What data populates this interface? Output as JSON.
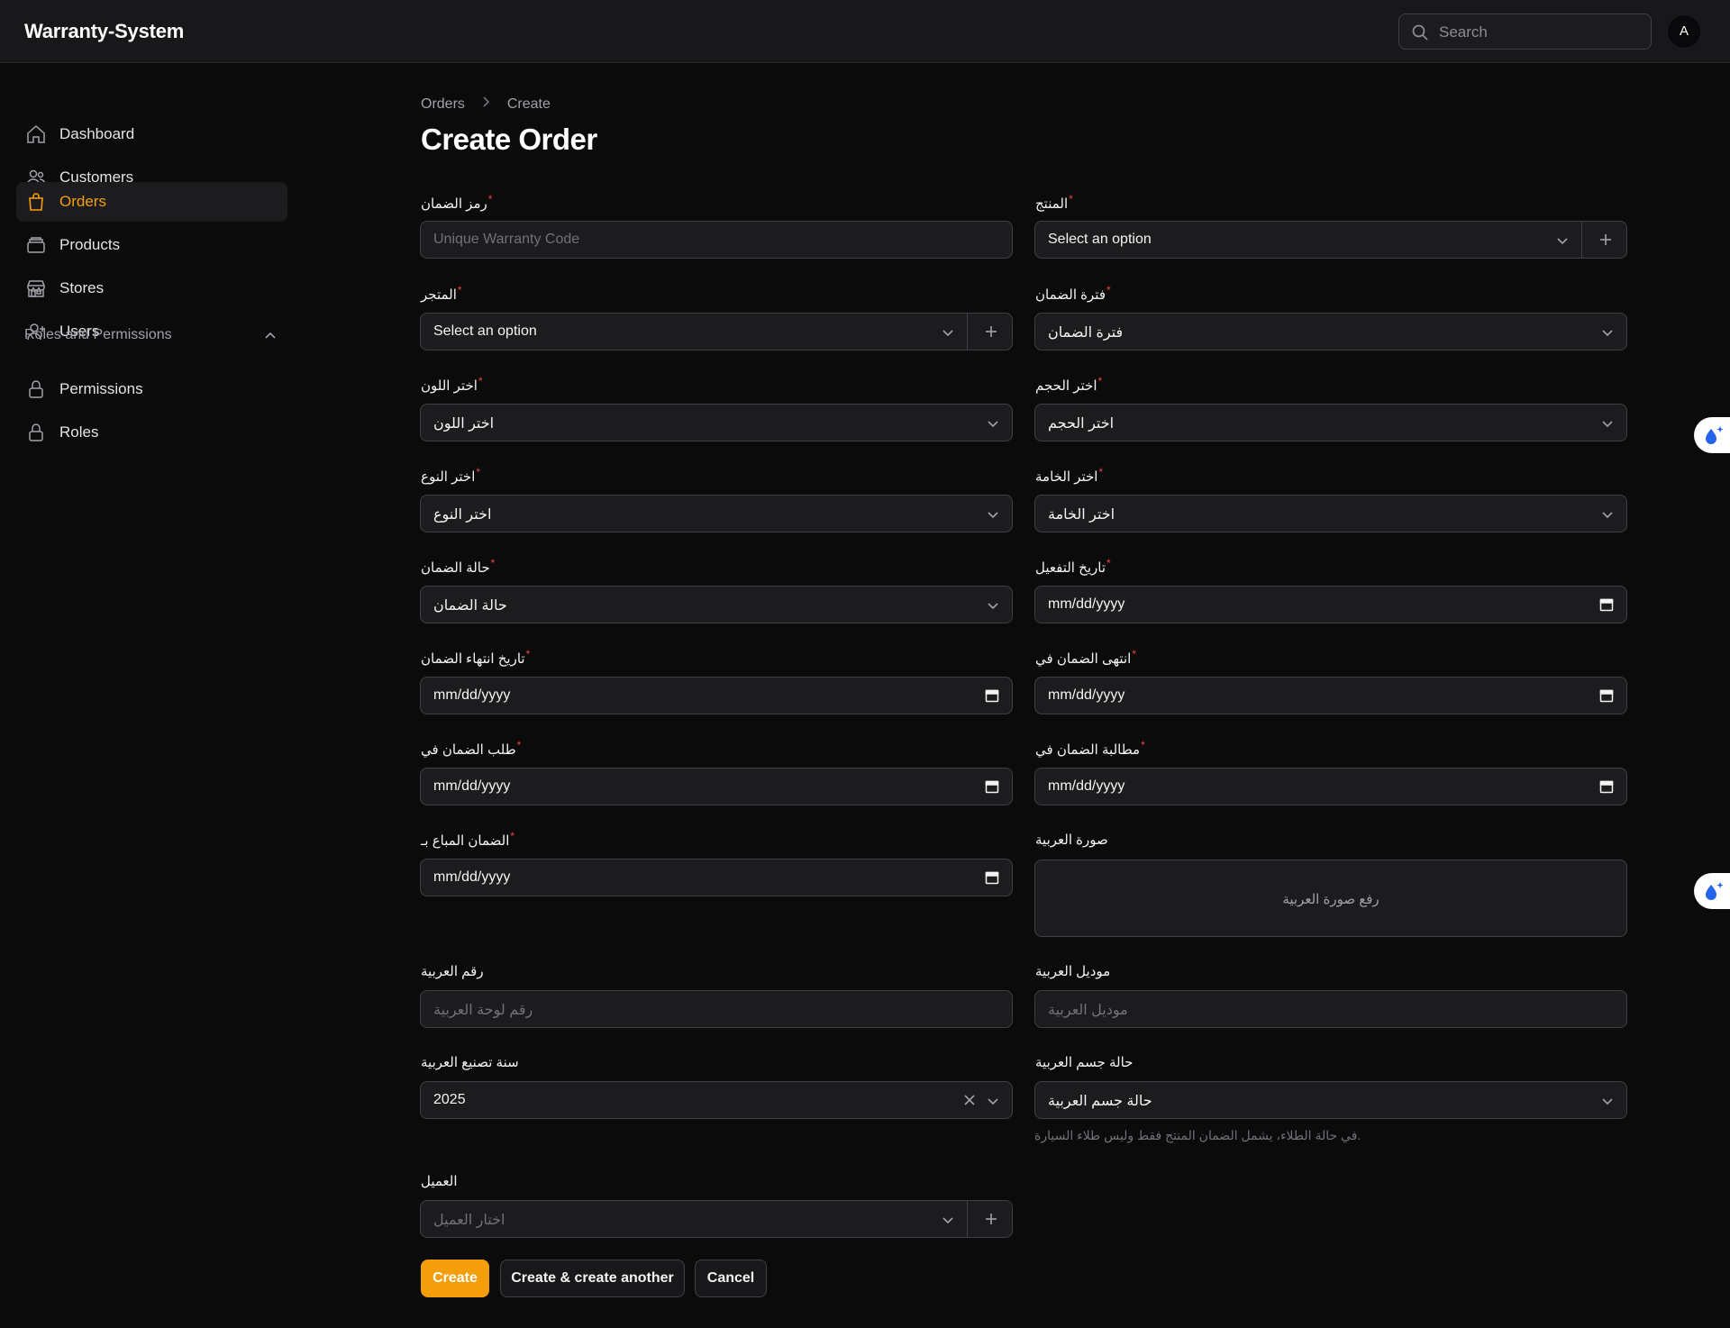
{
  "app": {
    "title": "Warranty-System",
    "avatar_initial": "A"
  },
  "search": {
    "placeholder": "Search"
  },
  "sidebar": {
    "items": [
      {
        "label": "Dashboard",
        "icon": "home-icon",
        "active": false
      },
      {
        "label": "Customers",
        "icon": "users-icon",
        "active": false
      },
      {
        "label": "Orders",
        "icon": "shopping-bag-icon",
        "active": true
      },
      {
        "label": "Products",
        "icon": "box-icon",
        "active": false
      },
      {
        "label": "Stores",
        "icon": "store-icon",
        "active": false
      },
      {
        "label": "Users",
        "icon": "user-plus-icon",
        "active": false
      }
    ],
    "group": {
      "label": "Roles and Permissions",
      "items": [
        {
          "label": "Permissions",
          "icon": "lock-icon"
        },
        {
          "label": "Roles",
          "icon": "lock-icon"
        }
      ]
    }
  },
  "breadcrumb": {
    "parent": "Orders",
    "current": "Create"
  },
  "page": {
    "title": "Create Order"
  },
  "form": {
    "warranty_code": {
      "label": "رمز الضمان",
      "placeholder": "Unique Warranty Code"
    },
    "product": {
      "label": "المنتج",
      "value": "Select an option"
    },
    "store": {
      "label": "المتجر",
      "value": "Select an option"
    },
    "warranty_period": {
      "label": "فترة الضمان",
      "value": "فترة الضمان"
    },
    "color": {
      "label": "اختر اللون",
      "value": "اختر اللون"
    },
    "size": {
      "label": "اختر الحجم",
      "value": "اختر الحجم"
    },
    "type": {
      "label": "اختر النوع",
      "value": "اختر النوع"
    },
    "material": {
      "label": "اختر الخامة",
      "value": "اختر الخامة"
    },
    "warranty_status": {
      "label": "حالة الضمان",
      "value": "حالة الضمان"
    },
    "activation_date": {
      "label": "تاريخ التفعيل",
      "value": "mm/dd/yyyy"
    },
    "warranty_end_date": {
      "label": "تاريخ انتهاء الضمان",
      "value": "mm/dd/yyyy"
    },
    "warranty_ended_at": {
      "label": "انتهى الضمان في",
      "value": "mm/dd/yyyy"
    },
    "warranty_requested_at": {
      "label": "طلب الضمان في",
      "value": "mm/dd/yyyy"
    },
    "warranty_claimed_at": {
      "label": "مطالبة الضمان في",
      "value": "mm/dd/yyyy"
    },
    "warranty_sold_at": {
      "label": "الضمان المباع بـ",
      "value": "mm/dd/yyyy"
    },
    "car_image": {
      "label": "صورة العربية",
      "upload_text": "رفع صورة العربية"
    },
    "car_plate": {
      "label": "رقم العربية",
      "placeholder": "رقم لوحة العربية"
    },
    "car_model": {
      "label": "موديل العربية",
      "placeholder": "موديل العربية"
    },
    "car_year": {
      "label": "سنة تصنيع العربية",
      "value": "2025"
    },
    "car_body": {
      "label": "حالة جسم العربية",
      "value": "حالة جسم العربية",
      "helper": "في حالة الطلاء، يشمل الضمان المنتج فقط وليس طلاء السيارة."
    },
    "customer": {
      "label": "العميل",
      "placeholder": "اختار العميل"
    }
  },
  "actions": {
    "create": "Create",
    "create_another": "Create & create another",
    "cancel": "Cancel"
  },
  "colors": {
    "accent": "#f59e0b",
    "background": "#0b0b0c",
    "required": "#ef4444"
  }
}
